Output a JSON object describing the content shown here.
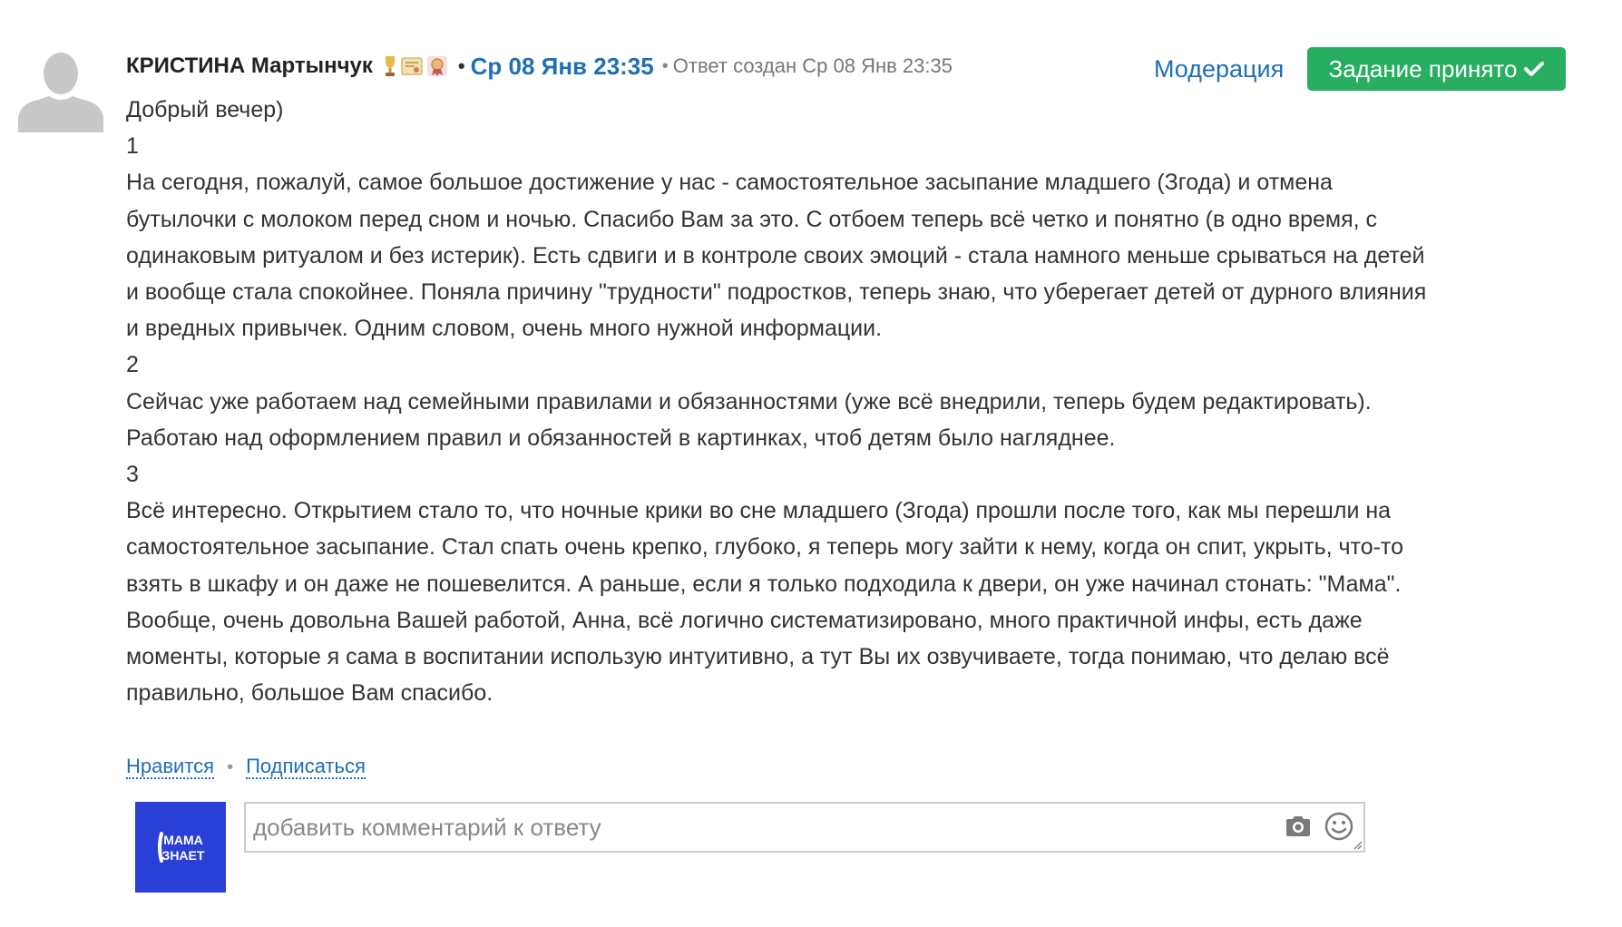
{
  "post": {
    "author": "КРИСТИНА Мартынчук",
    "badges": [
      "trophy-icon",
      "diploma-icon",
      "medal-icon"
    ],
    "date": "Ср 08 Янв 23:35",
    "created": "Ответ создан Ср 08 Янв 23:35",
    "body_lines": [
      "Добрый вечер)",
      "1",
      "На сегодня, пожалуй, самое большое достижение у нас - самостоятельное засыпание младшего (Згода) и отмена",
      "бутылочки с молоком перед сном и ночью. Спасибо Вам за это. С отбоем теперь всё четко и понятно (в одно время, с",
      "одинаковым ритуалом и без истерик). Есть сдвиги и в контроле своих эмоций - стала намного меньше срываться на детей",
      "и вообще стала спокойнее. Поняла причину \"трудности\" подростков, теперь знаю, что уберегает детей от дурного влияния",
      "и вредных привычек. Одним словом, очень много нужной информации.",
      "2",
      "Сейчас уже работаем над семейными правилами и обязанностями (уже всё внедрили, теперь будем редактировать).",
      "Работаю над оформлением правил и обязанностей в картинках, чтоб детям было нагляднее.",
      "3",
      "Всё интересно. Открытием стало то, что ночные крики во сне младшего (Згода) прошли после того, как мы перешли на",
      "самостоятельное засыпание. Стал спать очень крепко, глубоко, я теперь могу зайти к нему, когда он спит, укрыть, что-то",
      "взять в шкафу и он даже не пошевелится. А раньше, если я только подходила к двери, он уже начинал стонать: \"Мама\".",
      "Вообще, очень довольна Вашей работой, Анна, всё логично систематизировано, много практичной инфы, есть даже",
      "моменты, которые я сама в воспитании использую интуитивно, а тут Вы их озвучиваете, тогда понимаю, что делаю всё",
      "правильно, большое Вам спасибо."
    ]
  },
  "moderation_label": "Модерация",
  "accepted_label": "Задание принято",
  "actions": {
    "like": "Нравится",
    "subscribe": "Подписаться"
  },
  "comment": {
    "avatar_text_line1": "МАМА",
    "avatar_text_line2": "ЗНАЕТ",
    "placeholder": "добавить комментарий к ответу"
  },
  "colors": {
    "link": "#1e6fb5",
    "accepted_bg": "#27ae60",
    "avatar_bg": "#2a3fd6"
  }
}
